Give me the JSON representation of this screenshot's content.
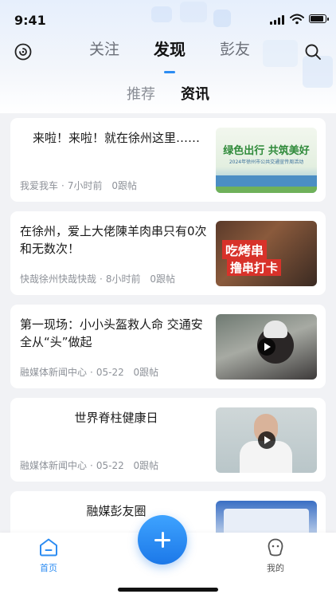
{
  "status_bar": {
    "time": "9:41"
  },
  "top_nav": {
    "tabs": [
      {
        "label": "关注"
      },
      {
        "label": "发现"
      },
      {
        "label": "彭友"
      }
    ],
    "active_tab": "发现"
  },
  "sub_tabs": [
    {
      "label": "推荐"
    },
    {
      "label": "资讯"
    }
  ],
  "active_sub_tab": "资讯",
  "feed": [
    {
      "title": "来啦！来啦！就在徐州这里……",
      "source": "我爱我车",
      "time": "7小时前",
      "comments": "0跟帖",
      "thumb_headline": "绿色出行 共筑美好",
      "thumb_caption": "2024年徐州市公共交通宣传周活动",
      "has_video": false
    },
    {
      "title": "在徐州，爱上大佬陳羊肉串只有0次和无数次！",
      "source": "快哉徐州快哉快哉",
      "time": "8小时前",
      "comments": "0跟帖",
      "thumb_headline": "吃烤串",
      "thumb_caption": "撸串打卡",
      "has_video": false
    },
    {
      "title": "第一现场：小小头盔救人命 交通安全从“头”做起",
      "source": "融媒体新闻中心",
      "time": "05-22",
      "comments": "0跟帖",
      "has_video": true
    },
    {
      "title": "世界脊柱健康日",
      "source": "融媒体新闻中心",
      "time": "05-22",
      "comments": "0跟帖",
      "has_video": true
    },
    {
      "title": "融媒彭友圈",
      "source": "",
      "time": "",
      "comments": "",
      "has_video": false
    }
  ],
  "bottom_nav": {
    "home_label": "首页",
    "mine_label": "我的"
  },
  "colors": {
    "accent": "#2c8cf2",
    "fab_top": "#3ea3ff",
    "fab_bottom": "#1c78e8"
  }
}
